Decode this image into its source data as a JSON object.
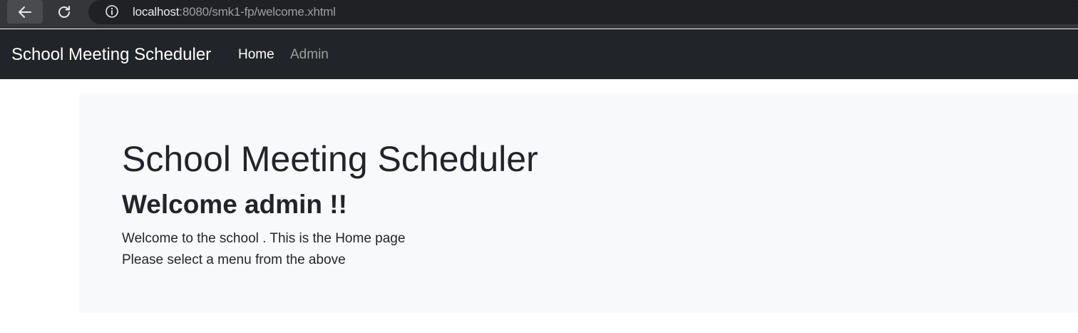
{
  "browser": {
    "url_host": "localhost",
    "url_rest": ":8080/smk1-fp/welcome.xhtml",
    "icons": {
      "back": "arrow-left-icon",
      "reload": "reload-icon",
      "info": "info-icon"
    }
  },
  "navbar": {
    "brand": "School Meeting Scheduler",
    "links": [
      {
        "label": "Home",
        "active": true
      },
      {
        "label": "Admin",
        "active": false
      }
    ]
  },
  "main": {
    "title": "School Meeting Scheduler",
    "welcome": "Welcome admin !!",
    "line1": "Welcome to the school . This is the Home page",
    "line2": "Please select a menu from the above"
  },
  "colors": {
    "navbar_bg": "#212529",
    "jumbotron_bg": "#f8f9fa",
    "text": "#212529",
    "chrome_bg": "#35363a"
  }
}
